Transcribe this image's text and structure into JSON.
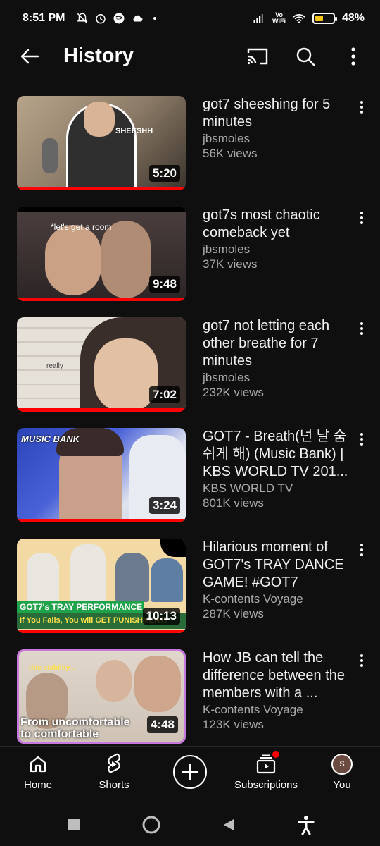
{
  "status": {
    "time": "8:51 PM",
    "vowifi_top": "Vo",
    "vowifi_bottom": "WiFi",
    "battery": "48%",
    "battery_level": 0.48
  },
  "header": {
    "title": "History"
  },
  "videos": [
    {
      "title": "got7 sheeshing for 5 minutes",
      "channel": "jbsmoles",
      "views": "56K views",
      "duration": "5:20",
      "caption": "SHEESHH"
    },
    {
      "title": "got7s most chaotic comeback yet",
      "channel": "jbsmoles",
      "views": "37K views",
      "duration": "9:48",
      "caption": "*let's get a room"
    },
    {
      "title": "got7 not letting each other breathe for 7 minutes",
      "channel": "jbsmoles",
      "views": "232K views",
      "duration": "7:02",
      "caption": "really"
    },
    {
      "title": "GOT7 - Breath(넌 날 숨 쉬게 해) (Music Bank) | KBS WORLD TV 201...",
      "channel": "KBS WORLD TV",
      "views": "801K views",
      "duration": "3:24",
      "caption": "MUSIC BANK"
    },
    {
      "title": "Hilarious moment of GOT7's TRAY DANCE GAME! #GOT7",
      "channel": "K-contents Voyage",
      "views": "287K views",
      "duration": "10:13",
      "caption": "GOT7's TRAY PERFORMANCE",
      "caption2": "If You Fails, You will GET PUNISHMENT!"
    },
    {
      "title": "How JB can tell the difference between the members with a ...",
      "channel": "K-contents Voyage",
      "views": "123K views",
      "duration": "4:48",
      "caption": "this stability...",
      "caption2": "From uncomfortable to comfortable"
    }
  ],
  "nav": {
    "home": "Home",
    "shorts": "Shorts",
    "subscriptions": "Subscriptions",
    "you": "You",
    "avatar_initial": "S"
  }
}
